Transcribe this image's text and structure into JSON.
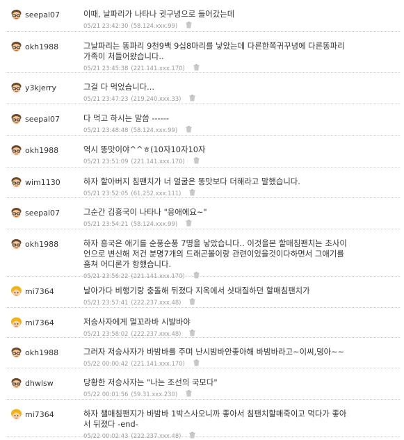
{
  "comments": [
    {
      "user": "seepal07",
      "avatar": "brown",
      "text": "이때, 날파리가 나타나 귓구녕으로 들어갔는데",
      "time": "05/21 23:42:30",
      "ip": "(58.124.xxx.99)"
    },
    {
      "user": "okh1988",
      "avatar": "brown",
      "text": "그날파리는 똥파리 9천9백 9십8마리를 낳았는데 다른한쪽귀꾸녕에 다른똥파리\n가족이 처들어왔습니다..",
      "time": "05/21 23:45:38",
      "ip": "(221.141.xxx.170)"
    },
    {
      "user": "y3kjerry",
      "avatar": "brown",
      "text": "그걸 다 먹었습니다...",
      "time": "05/21 23:47:23",
      "ip": "(219.240.xxx.33)"
    },
    {
      "user": "seepal07",
      "avatar": "brown",
      "text": "다 먹고 하시는 말씀 ------",
      "time": "05/21 23:48:48",
      "ip": "(58.124.xxx.99)"
    },
    {
      "user": "okh1988",
      "avatar": "brown",
      "text": "역시 똥맛이야^^ㅎ(10자10자10자",
      "time": "05/21 23:51:09",
      "ip": "(221.141.xxx.170)"
    },
    {
      "user": "wim1130",
      "avatar": "brown",
      "text": "하자 할아버지 침팬치가 너 얼굴은 똥맛보다 더해라고 말했습니다.",
      "time": "05/21 23:52:05",
      "ip": "(61.252.xxx.111)"
    },
    {
      "user": "seepal07",
      "avatar": "brown",
      "text": "그순간 김흥국이 나타나 \"응애에요~\"",
      "time": "05/21 23:54:21",
      "ip": "(58.124.xxx.99)"
    },
    {
      "user": "okh1988",
      "avatar": "brown",
      "text": "하자 흥국은 애기를 순풍순풍 7명을 낳았습니다.. 이것을본 할매침팬치는 초사이\n언으로 변신해 저건 분명7개의 드래곤볼이랑 관련이있을것이다하면서 그애기를\n훔쳐 어디론가 항했습니다.",
      "time": "05/21 23:56:22",
      "ip": "(221.141.xxx.170)"
    },
    {
      "user": "mi7364",
      "avatar": "blonde",
      "text": "날아가다 비행기랑 충돌해 뒤졌다 지옥에서 샷대질하던 할매침팬치가",
      "time": "05/21 23:57:41",
      "ip": "(222.237.xxx.48)"
    },
    {
      "user": "mi7364",
      "avatar": "blonde",
      "text": "저승사자에게 멀꼬라바 시발바야",
      "time": "05/21 23:58:02",
      "ip": "(222.237.xxx.48)"
    },
    {
      "user": "okh1988",
      "avatar": "brown",
      "text": "그러자 저승사자가 바밤바를 주며 난시밤바안좋아해 바밤바라고~이씨,댕아~~",
      "time": "05/22 00:00:42",
      "ip": "(221.141.xxx.170)"
    },
    {
      "user": "dhwlsw",
      "avatar": "brown",
      "text": "당황한 저승사자는 \"나는 조선의 국모다\"",
      "time": "05/22 00:01:56",
      "ip": "(59.31.xxx.230)"
    },
    {
      "user": "mi7364",
      "avatar": "blonde",
      "text": "하자 챌매침팬지가 바밤바 1박스사오니까 좋아서 침팬치할매죽이고 먹다가 좋아\n서 뒤졌다 -end-",
      "time": "05/22 00:02:43",
      "ip": "(222.237.xxx.48)"
    }
  ]
}
